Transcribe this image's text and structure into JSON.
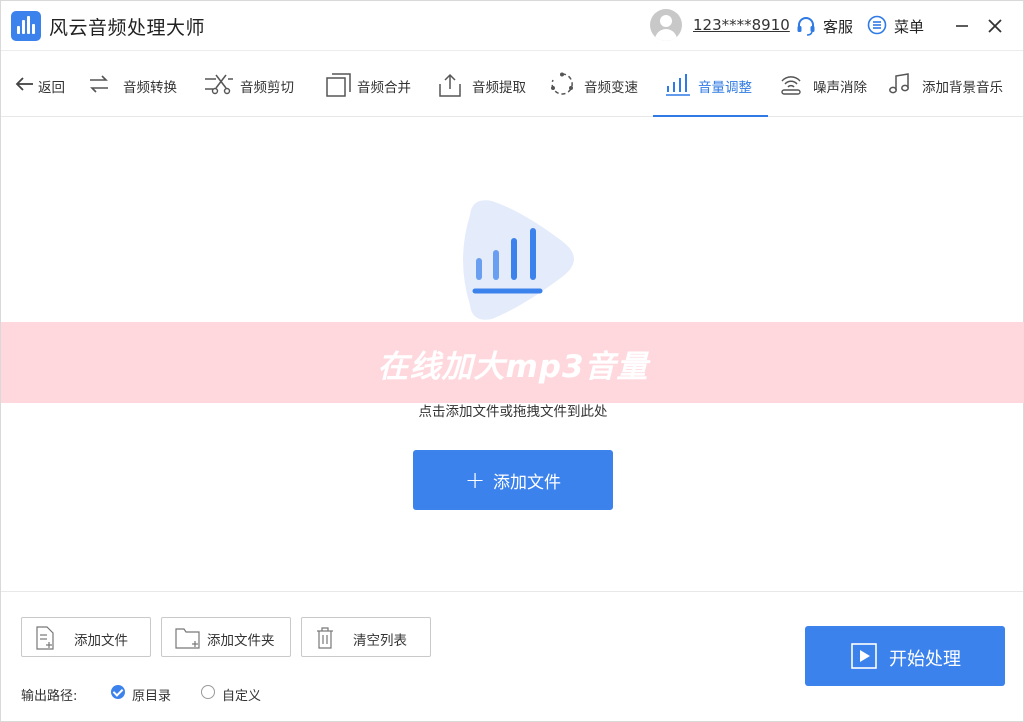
{
  "app": {
    "title": "风云音频处理大师",
    "user_phone": "123****8910",
    "service_label": "客服",
    "menu_label": "菜单"
  },
  "toolbar": {
    "back_label": "返回",
    "tools": [
      {
        "label": "音频转换",
        "icon": "convert-icon"
      },
      {
        "label": "音频剪切",
        "icon": "scissors-icon"
      },
      {
        "label": "音频合并",
        "icon": "merge-icon"
      },
      {
        "label": "音频提取",
        "icon": "extract-icon"
      },
      {
        "label": "音频变速",
        "icon": "speed-icon"
      },
      {
        "label": "音量调整",
        "icon": "volume-bars-icon",
        "active": true
      },
      {
        "label": "噪声消除",
        "icon": "noise-icon"
      },
      {
        "label": "添加背景音乐",
        "icon": "music-note-icon"
      }
    ]
  },
  "main": {
    "overlay_text": "在线加大mp3音量",
    "hint": "点击添加文件或拖拽文件到此处",
    "add_file_label": "添加文件"
  },
  "bottom": {
    "add_file_label": "添加文件",
    "add_folder_label": "添加文件夹",
    "clear_list_label": "清空列表",
    "output_path_label": "输出路径:",
    "option_original": "原目录",
    "option_custom": "自定义",
    "start_label": "开始处理"
  },
  "colors": {
    "accent": "#3c82ec",
    "active_tab": "#2f7ae5",
    "banner": "#ffd6dc"
  }
}
